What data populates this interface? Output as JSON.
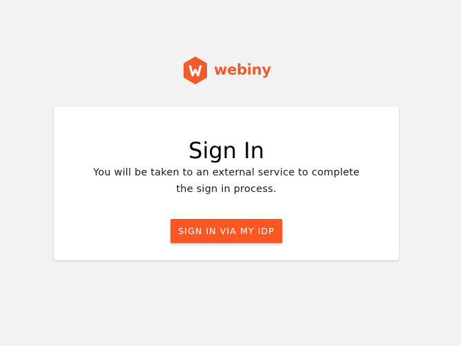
{
  "brand": {
    "name": "webiny",
    "logo_icon": "webiny-hexagon-icon",
    "color": "#f05b2a"
  },
  "signin": {
    "title": "Sign In",
    "description": "You will be taken to an external service to complete the sign in process.",
    "button_label": "SIGN IN VIA MY IDP",
    "button_color": "#fa5723"
  },
  "page": {
    "background": "#f2f2f2"
  }
}
